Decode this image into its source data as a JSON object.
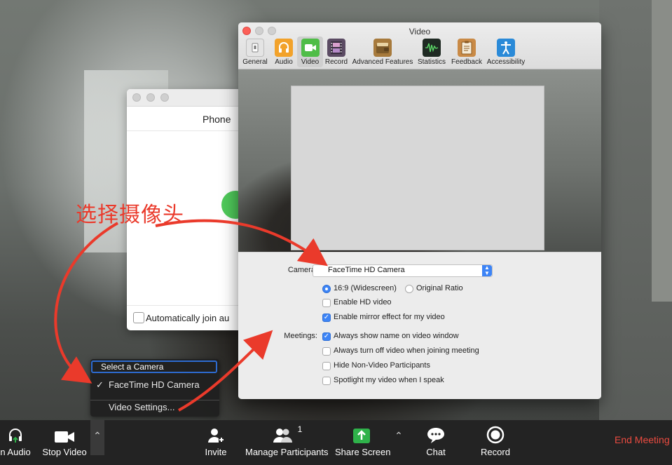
{
  "phone_dialog": {
    "title": "Phone",
    "auto_join_label": "Automatically join au"
  },
  "video_window": {
    "title": "Video",
    "tabs": [
      {
        "label": "General",
        "icon": "general-icon",
        "color": "#e8e8e8"
      },
      {
        "label": "Audio",
        "icon": "headphones-icon",
        "color": "#f2a22a"
      },
      {
        "label": "Video",
        "icon": "video-camera-icon",
        "color": "#4fbd47"
      },
      {
        "label": "Record",
        "icon": "film-strip-icon",
        "color": "#5b4b63"
      },
      {
        "label": "Advanced Features",
        "icon": "wallet-icon",
        "color": "#a77a3c"
      },
      {
        "label": "Statistics",
        "icon": "waveform-icon",
        "color": "#1f2a23"
      },
      {
        "label": "Feedback",
        "icon": "clipboard-icon",
        "color": "#c98a46"
      },
      {
        "label": "Accessibility",
        "icon": "accessibility-icon",
        "color": "#2a8ad8"
      }
    ],
    "active_tab": "Video",
    "camera_label": "Camera:",
    "camera_value": "FaceTime HD Camera",
    "ratio_widescreen": "16:9 (Widescreen)",
    "ratio_original": "Original Ratio",
    "enable_hd": "Enable HD video",
    "mirror": "Enable mirror effect for my video",
    "meetings_label": "Meetings:",
    "always_show_name": "Always show name on video window",
    "always_turn_off": "Always turn off video when joining meeting",
    "hide_non_video": "Hide Non-Video Participants",
    "spotlight": "Spotlight my video when I speak"
  },
  "camera_menu": {
    "header": "Select a Camera",
    "checkmark": "✓",
    "camera_option": "FaceTime HD Camera",
    "settings_item": "Video Settings..."
  },
  "annotation": "选择摄像头",
  "toolbar": {
    "join_audio": "n Audio",
    "stop_video": "Stop Video",
    "invite": "Invite",
    "manage_participants": "Manage Participants",
    "participant_count": "1",
    "share_screen": "Share Screen",
    "chat": "Chat",
    "record": "Record",
    "end_meeting": "End Meeting"
  },
  "colors": {
    "accent_blue": "#3d84f6",
    "end_meeting_red": "#ea4b40",
    "annotation_red": "#ea3a2b",
    "share_green": "#2fb24a"
  }
}
